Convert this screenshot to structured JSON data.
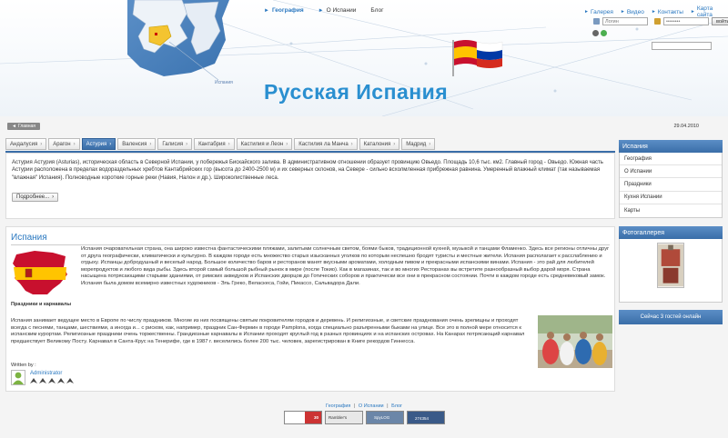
{
  "header": {
    "title": "Русская Испания",
    "map_caption": "Испания",
    "nav": [
      {
        "label": "География",
        "active": true
      },
      {
        "label": "О Испании",
        "active": false
      },
      {
        "label": "Блог",
        "active": false
      }
    ],
    "top_links": [
      "Галерея",
      "Видео",
      "Контакты",
      "Карта сайта"
    ],
    "login": {
      "username_placeholder": "Логин",
      "password_value": "••••••••",
      "submit_label": "войти",
      "register_label": "go"
    },
    "colors": {
      "accent": "#2a78c0",
      "title": "#2a8fd0"
    }
  },
  "crumb": {
    "home_label": "Главная",
    "date": "29.04.2010"
  },
  "tabs": [
    "Андалусия",
    "Арагон",
    "Астурия",
    "Валенсия",
    "Галисия",
    "Кантабрия",
    "Кастилия и Леон",
    "Кастилия ла Манча",
    "Каталония",
    "Мадрид"
  ],
  "active_tab": 2,
  "region": {
    "text": "Астурия Астурия (Asturias), историческая область в Северной Испании, у побережья Бискайского залива. В административном отношении образует провинцию Овьедо. Площадь 10,6 тыс. км2. Главный город - Овьедо. Южная часть Астурии расположена в пределах водораздельных хребтов Кантабрийских гор (высота до 2400-2500 м) и их северных склонов, на Севере - сильно всхолмленная прибрежная равнина. Умеренный влажный климат (так называемая \"влажная\" Испания). Полноводные короткие горные реки (Навия, Налон и др.). Широколиственные леса.",
    "more_label": "Подробнее..."
  },
  "article": {
    "title": "Испания",
    "subheading": "Праздники и карнавалы",
    "para1": "Испания очаровательная страна, она широко известна фантастическими пляжами, залитыми солнечным светом, боями быков, традиционной кухней, музыкой и танцами Фламенко. Здесь все регионы отличны друг от друга географически, климатически и культурно. В каждом городе есть множество старых изысканных уголков по которым неспешно бродят туристы и местные жители. Испания располагает к расслаблению и отдыху. Испанцы добродушный и веселый народ. Большое количество баров и ресторанов манят вкусными ароматами, холодным пивом и прекрасными испанскими винами. Испания - это рай для любителей морепродуктов и любого вида рыбы. Здесь второй самый большой рыбный рынок в мире (после Токио). Как в магазинах, так и во многих Ресторанах вы встретите разнообразный выбор дарой моря. Страна насыщена потрясающими старыми зданиями, от римских акведуков и Испанских дворцов до Готических соборов и практически все они в прекрасном состоянии. Почти в каждом городе есть средневековый замок. Испания была домом всемирно известных художников - Эль Греко, Веласкеса, Гойи, Пикассо, Сальвадора Дали.",
    "para2": "Испания занимает ведущее место в Европе по числу праздников. Многие из них посвящены святым покровителям городов и деревень. И религиозные, и светские празднования очень зрелищны и проходят всегда с песнями, танцами, шествиями, а иногда и... с риском, как, например, праздник Сан-Фермин в городе Pamplona, когда специально разъяренными быками на улице. Все это в полной мере относится к испанским курортам. Религиозные праздники очень торжественны. Грандиозные карнавалы в Испании проходят круглый год в разных провинциях и на испанских островах. На Канарах потрясающий карнавал предшествует Великому Посту. Карнавал в Санта-Крус на Тенерифе, где в 1987 г. веселились более 200 тыс. человек, зарегистрирован в Книге рекордов Гиннесса.",
    "written_by": "Written by :",
    "author": "Administrator",
    "rating": 5
  },
  "sidebar": {
    "menu_title": "Испания",
    "menu_items": [
      "География",
      "О Испании",
      "Праздники",
      "Кухня Испании",
      "Карты"
    ],
    "gallery_title": "Фотогаллерея",
    "online_text": "Сейчас 3 гостей онлайн"
  },
  "footer": {
    "links": [
      "География",
      "О Испании",
      "Блог"
    ],
    "separator": "|",
    "badges": [
      "30",
      "Rambler's",
      "SpyLOG",
      "274354"
    ]
  }
}
